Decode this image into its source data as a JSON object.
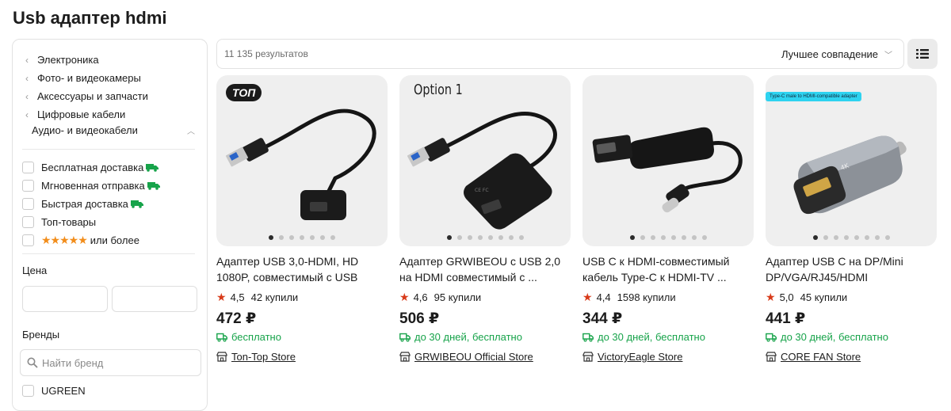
{
  "page": {
    "title": "Usb адаптер hdmi"
  },
  "sidebar": {
    "categories": [
      "Электроника",
      "Фото- и видеокамеры",
      "Аксессуары и запчасти",
      "Цифровые кабели"
    ],
    "current_category": "Аудио- и видеокабели",
    "filters": [
      "Бесплатная доставка",
      "Мгновенная отправка",
      "Быстрая доставка",
      "Топ-товары"
    ],
    "rating_filter": {
      "stars": "★★★★★",
      "label": "или более",
      "min_rating": 4.5
    },
    "price": {
      "label": "Цена"
    },
    "brands": {
      "label": "Бренды",
      "search_placeholder": "Найти бренд",
      "items": [
        "UGREEN"
      ]
    }
  },
  "toolbar": {
    "results": "11 135 результатов",
    "sort": "Лучшее совпадение"
  },
  "colors": {
    "accent_green": "#17a34a",
    "star_red": "#d83b1a",
    "star_orange": "#f28d1b"
  },
  "products": [
    {
      "badge": "ТОП",
      "title": "Адаптер USB 3,0-HDMI, HD 1080P, совместимый с USB",
      "rating": "4,5",
      "bought": "42 купили",
      "price": "472 ₽",
      "delivery": "бесплатно",
      "store": "Ton-Top Store"
    },
    {
      "image_label": "Option 1",
      "title": "Адаптер GRWIBEOU с USB 2,0 на HDMI совместимый с ...",
      "rating": "4,6",
      "bought": "95 купили",
      "price": "506 ₽",
      "delivery": "до 30 дней, бесплатно",
      "store": "GRWIBEOU Official Store"
    },
    {
      "title": "USB C к HDMI-совместимый кабель Type-C к HDMI-TV ...",
      "rating": "4,4",
      "bought": "1598 купили",
      "price": "344 ₽",
      "delivery": "до 30 дней, бесплатно",
      "store": "VictoryEagle Store"
    },
    {
      "image_label": "Type-C male to HDMI-compatible adapter",
      "title": "Адаптер USB C на DP/Mini DP/VGA/RJ45/HDMI",
      "rating": "5,0",
      "bought": "45 купили",
      "price": "441 ₽",
      "delivery": "до 30 дней, бесплатно",
      "store": "CORE FAN Store"
    }
  ]
}
